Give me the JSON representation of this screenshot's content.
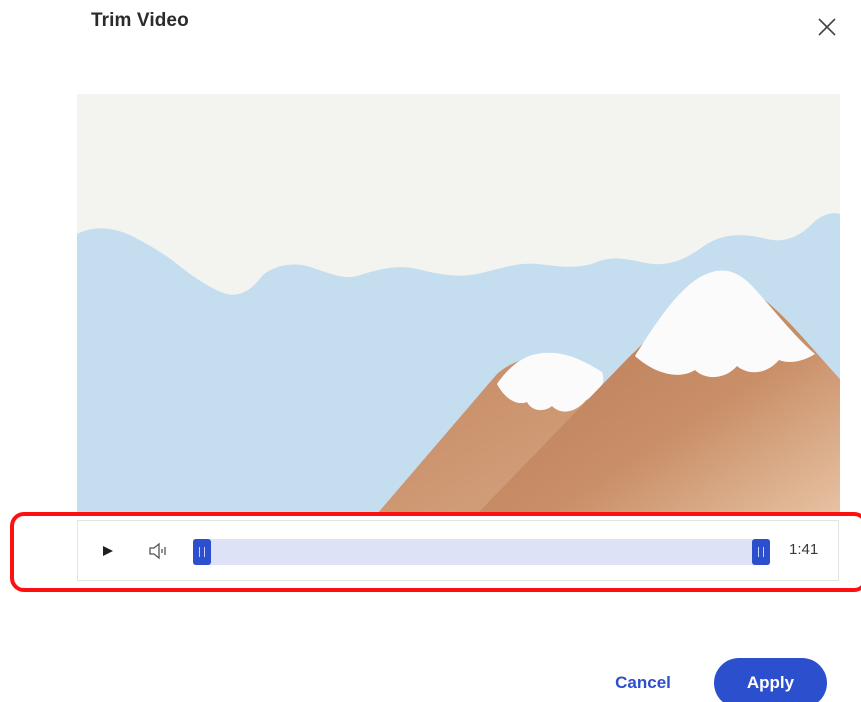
{
  "dialog": {
    "title": "Trim Video",
    "close_icon": "close-icon"
  },
  "video": {
    "scene": "animated-mountains-thumbnail"
  },
  "controls": {
    "play_icon": "play-icon",
    "volume_icon": "volume-icon",
    "trim_start_fraction": 0.0,
    "trim_end_fraction": 1.0,
    "duration": "1:41"
  },
  "footer": {
    "cancel_label": "Cancel",
    "apply_label": "Apply"
  },
  "colors": {
    "accent": "#2c4fce",
    "track": "#dee2f6",
    "highlight": "#ff1010"
  }
}
